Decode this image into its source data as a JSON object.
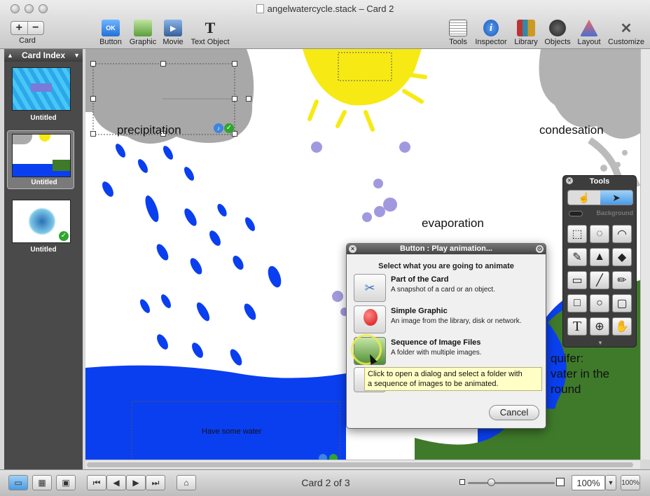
{
  "window": {
    "title": "angelwatercycle.stack – Card 2"
  },
  "toolbar": {
    "card_label": "Card",
    "button_label": "Button",
    "graphic_label": "Graphic",
    "movie_label": "Movie",
    "text_label": "Text Object",
    "tools_label": "Tools",
    "inspector_label": "Inspector",
    "library_label": "Library",
    "objects_label": "Objects",
    "layout_label": "Layout",
    "customize_label": "Customize"
  },
  "sidebar": {
    "title": "Card Index",
    "cards": [
      {
        "label": "Untitled"
      },
      {
        "label": "Untitled"
      },
      {
        "label": "Untitled"
      }
    ]
  },
  "canvas": {
    "labels": {
      "precipitation": "precipitation",
      "condensation": "condesation",
      "evaporation": "evaporation",
      "aquifer_1": "quifer:",
      "aquifer_2": "vater in the",
      "aquifer_3": "round",
      "water_button": "Have some water"
    }
  },
  "dialog": {
    "title": "Button : Play animation...",
    "prompt": "Select what you are going to animate",
    "options": [
      {
        "title": "Part of the Card",
        "desc": "A snapshot of a card or an object."
      },
      {
        "title": "Simple Graphic",
        "desc": "An image from the library, disk or network."
      },
      {
        "title": "Sequence of Image Files",
        "desc": "A folder with multiple images."
      }
    ],
    "tooltip_line1": "Click to open a dialog and select a folder with",
    "tooltip_line2": "a sequence of images to be animated.",
    "cancel_label": "Cancel"
  },
  "tools_palette": {
    "title": "Tools",
    "background_label": "Background"
  },
  "bottombar": {
    "card_position": "Card 2 of 3",
    "zoom_value": "100%",
    "zoom_reset_label": "100%"
  },
  "colors": {
    "water_blue": "#0a3ff0",
    "sun_yellow": "#f7ea14",
    "cloud_gray": "#a8a8a8",
    "grass_green": "#3f7a2b"
  }
}
